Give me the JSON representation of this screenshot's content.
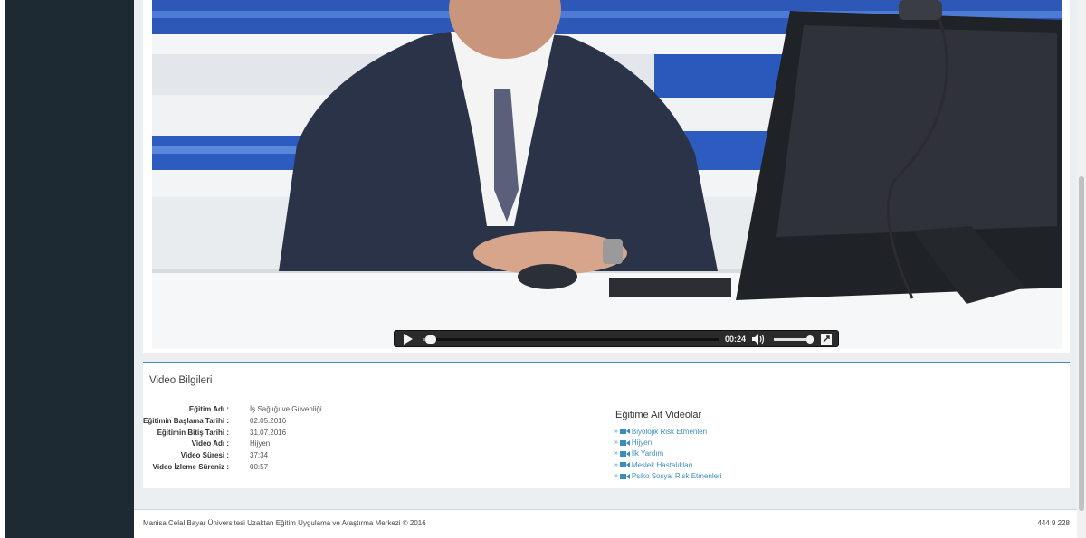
{
  "video": {
    "current_time": "00:24",
    "progress": 0.01,
    "volume": 0.9
  },
  "info": {
    "title": "Video Bilgileri",
    "rows": [
      {
        "label": "Eğitim Adı :",
        "value": "İş Sağlığı ve Güvenliği"
      },
      {
        "label": "Eğitimin Başlama Tarihi :",
        "value": "02.05.2016"
      },
      {
        "label": "Eğitimin Bitiş Tarihi :",
        "value": "31.07.2016"
      },
      {
        "label": "Video Adı :",
        "value": "Hijyen"
      },
      {
        "label": "Video Süresi :",
        "value": "37:34"
      },
      {
        "label": "Video İzleme Süreniz :",
        "value": "00:57"
      }
    ]
  },
  "related": {
    "title": "Eğitime Ait Videolar",
    "items": [
      {
        "label": "Biyolojik Risk Etmenleri"
      },
      {
        "label": "Hijyen"
      },
      {
        "label": "İlk Yardım"
      },
      {
        "label": "Meslek Hastalıkları"
      },
      {
        "label": "Psiko Sosyal Risk Etmenleri"
      }
    ],
    "bullet": "»",
    "icon": "video-camera-icon"
  },
  "footer": {
    "copyright": "Manisa Celal Bayar Üniversitesi Uzaktan Eğitim Uygulama ve Araştırma Merkezi © 2016",
    "phone": "444 9 228"
  },
  "colors": {
    "sidebar": "#1e2a33",
    "accent": "#3c8dbc",
    "background": "#eceff2"
  }
}
